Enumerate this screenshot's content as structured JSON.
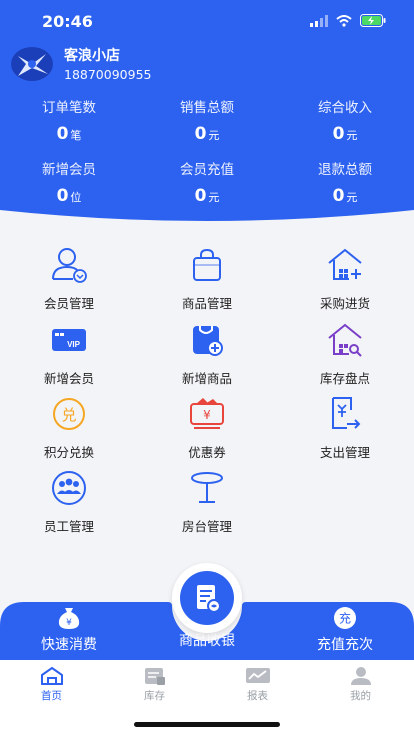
{
  "status": {
    "time": "20:46"
  },
  "shop": {
    "name": "客浪小店",
    "phone": "18870090955"
  },
  "stats": [
    {
      "label": "订单笔数",
      "value": "0",
      "unit": "笔"
    },
    {
      "label": "销售总额",
      "value": "0",
      "unit": "元"
    },
    {
      "label": "综合收入",
      "value": "0",
      "unit": "元"
    },
    {
      "label": "新增会员",
      "value": "0",
      "unit": "位"
    },
    {
      "label": "会员充值",
      "value": "0",
      "unit": "元"
    },
    {
      "label": "退款总额",
      "value": "0",
      "unit": "元"
    }
  ],
  "grid": [
    {
      "label": "会员管理",
      "icon": "member-icon"
    },
    {
      "label": "商品管理",
      "icon": "bag-icon"
    },
    {
      "label": "采购进货",
      "icon": "warehouse-plus-icon"
    },
    {
      "label": "新增会员",
      "icon": "vip-card-icon"
    },
    {
      "label": "新增商品",
      "icon": "product-add-icon"
    },
    {
      "label": "库存盘点",
      "icon": "warehouse-check-icon"
    },
    {
      "label": "积分兑换",
      "icon": "points-exchange-icon"
    },
    {
      "label": "优惠券",
      "icon": "coupon-icon"
    },
    {
      "label": "支出管理",
      "icon": "expense-icon"
    },
    {
      "label": "员工管理",
      "icon": "staff-icon"
    },
    {
      "label": "房台管理",
      "icon": "table-icon"
    }
  ],
  "actions": {
    "quick": {
      "label": "快速消费",
      "badge": "¥"
    },
    "checkout": {
      "label": "商品收银"
    },
    "recharge": {
      "label": "充值充次",
      "badge": "充"
    }
  },
  "tabs": [
    {
      "label": "首页",
      "active": true
    },
    {
      "label": "库存",
      "active": false
    },
    {
      "label": "报表",
      "active": false
    },
    {
      "label": "我的",
      "active": false
    }
  ],
  "colors": {
    "primary": "#2d62f0",
    "accent_red": "#e8453c",
    "accent_orange": "#f5a623",
    "accent_purple": "#7a3fc9"
  }
}
